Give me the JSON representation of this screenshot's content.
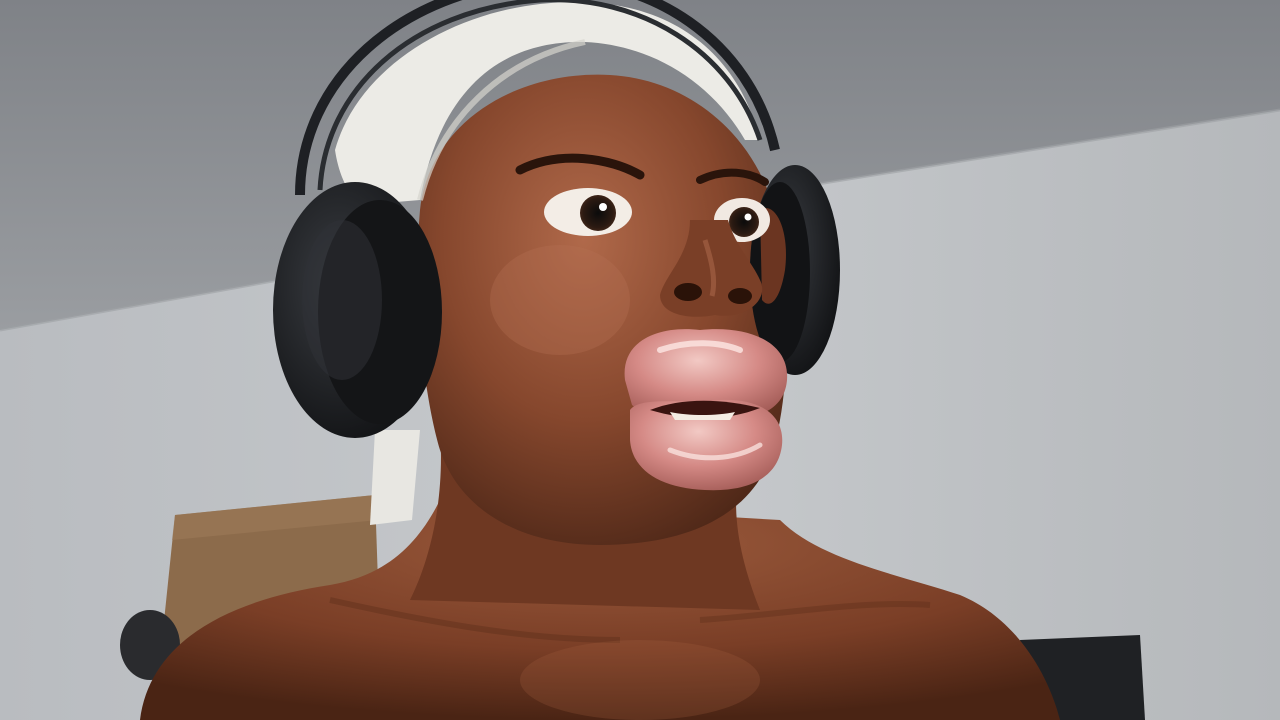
{
  "scene": {
    "subject": "person-wearing-headphones",
    "colors": {
      "ceiling": "#8c8f94",
      "wall_light": "#c4c7cb",
      "wall_shadow": "#a4a7ab",
      "skin_dark": "#5a2f1e",
      "skin_mid": "#8a4a30",
      "skin_light": "#b06a4a",
      "headband": "#ecebe6",
      "headphones": "#1b1d20",
      "lips": "#c97a7a",
      "lips_highlight": "#f0c4c0",
      "board": "#8a6a4a",
      "chair": "#1f2124"
    },
    "icons": [
      "headphones-icon"
    ]
  }
}
